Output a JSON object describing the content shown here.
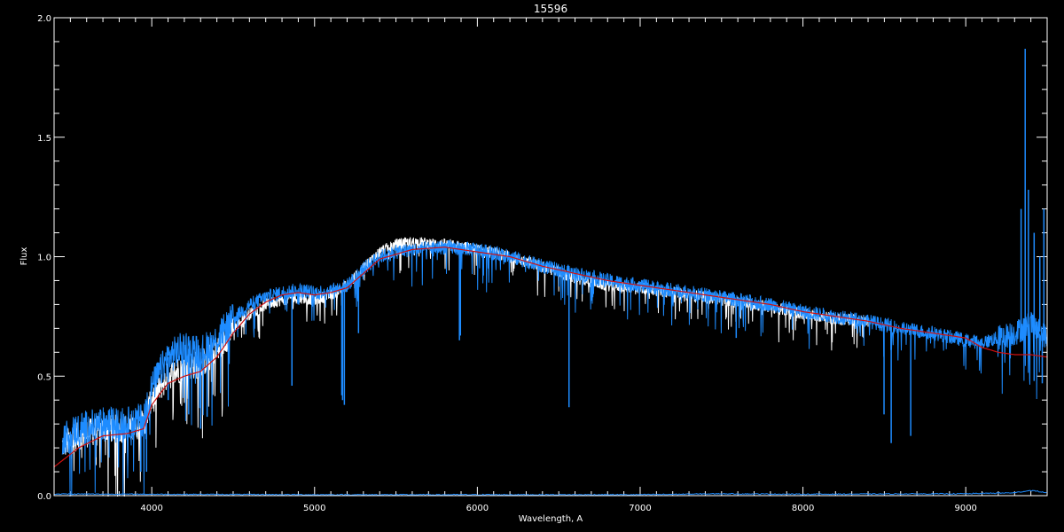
{
  "chart_data": {
    "type": "line",
    "title": "15596",
    "xlabel": "Wavelength, A",
    "ylabel": "Flux",
    "xlim": [
      3400,
      9500
    ],
    "ylim": [
      0.0,
      2.0
    ],
    "grid": false,
    "legend": "none",
    "x_ticks": [
      4000,
      5000,
      6000,
      7000,
      8000,
      9000
    ],
    "x_tick_labels": [
      "4000",
      "5000",
      "6000",
      "7000",
      "8000",
      "9000"
    ],
    "y_ticks": [
      0.0,
      0.5,
      1.0,
      1.5,
      2.0
    ],
    "y_tick_labels": [
      "0.0",
      "0.5",
      "1.0",
      "1.5",
      "2.0"
    ],
    "colors": {
      "background": "#000000",
      "axes": "#ffffff",
      "model_spectrum": "#ffffff",
      "observed_spectrum": "#1e8cff",
      "continuum_fit": "#d01010",
      "error_spectrum": "#1e8cff"
    },
    "series": [
      {
        "id": "continuum_fit",
        "x": [
          3400,
          3550,
          3700,
          3850,
          3950,
          4000,
          4100,
          4200,
          4300,
          4400,
          4500,
          4600,
          4700,
          4800,
          4900,
          5000,
          5100,
          5200,
          5300,
          5400,
          5600,
          5800,
          6000,
          6200,
          6400,
          6600,
          6800,
          7000,
          7200,
          7400,
          7600,
          7800,
          8000,
          8200,
          8400,
          8600,
          8800,
          9000,
          9100,
          9200,
          9300,
          9400,
          9500
        ],
        "y": [
          0.12,
          0.2,
          0.25,
          0.26,
          0.28,
          0.38,
          0.47,
          0.5,
          0.52,
          0.58,
          0.68,
          0.76,
          0.81,
          0.84,
          0.85,
          0.84,
          0.85,
          0.87,
          0.93,
          0.99,
          1.03,
          1.04,
          1.02,
          1.0,
          0.96,
          0.93,
          0.9,
          0.88,
          0.86,
          0.84,
          0.82,
          0.8,
          0.77,
          0.75,
          0.73,
          0.7,
          0.68,
          0.66,
          0.62,
          0.6,
          0.59,
          0.59,
          0.58
        ]
      },
      {
        "id": "model_spectrum",
        "x": [
          3450,
          3550,
          3700,
          3850,
          3950,
          4000,
          4100,
          4200,
          4300,
          4400,
          4500,
          4600,
          4700,
          4800,
          4900,
          5000,
          5100,
          5200,
          5300,
          5400,
          5500,
          5600,
          5800,
          6000,
          6200,
          6400,
          6600,
          6800,
          7000,
          7200,
          7400,
          7600,
          7800,
          8000,
          8200,
          8400
        ],
        "y": [
          0.21,
          0.25,
          0.28,
          0.28,
          0.3,
          0.4,
          0.5,
          0.54,
          0.55,
          0.6,
          0.7,
          0.76,
          0.8,
          0.82,
          0.83,
          0.82,
          0.84,
          0.88,
          0.95,
          1.02,
          1.05,
          1.06,
          1.05,
          1.03,
          1.0,
          0.96,
          0.91,
          0.88,
          0.87,
          0.85,
          0.83,
          0.81,
          0.79,
          0.76,
          0.74,
          0.73
        ]
      },
      {
        "id": "observed_spectrum",
        "x": [
          3450,
          3550,
          3700,
          3850,
          3950,
          4000,
          4100,
          4200,
          4300,
          4400,
          4500,
          4600,
          4700,
          4800,
          4900,
          5000,
          5100,
          5200,
          5300,
          5400,
          5500,
          5600,
          5800,
          6000,
          6200,
          6400,
          6600,
          6800,
          7000,
          7200,
          7400,
          7600,
          7800,
          8000,
          8200,
          8400,
          8600,
          8800,
          9000,
          9100,
          9200,
          9300,
          9400,
          9500
        ],
        "y": [
          0.24,
          0.28,
          0.3,
          0.3,
          0.32,
          0.45,
          0.58,
          0.62,
          0.6,
          0.65,
          0.74,
          0.8,
          0.83,
          0.85,
          0.86,
          0.85,
          0.86,
          0.88,
          0.95,
          1.0,
          1.02,
          1.03,
          1.04,
          1.03,
          1.0,
          0.96,
          0.93,
          0.9,
          0.88,
          0.86,
          0.84,
          0.82,
          0.8,
          0.77,
          0.75,
          0.73,
          0.7,
          0.68,
          0.65,
          0.64,
          0.66,
          0.68,
          0.72,
          0.66
        ]
      },
      {
        "id": "error_spectrum",
        "x": [
          3400,
          4000,
          5000,
          6000,
          7000,
          7500,
          8000,
          8500,
          9000,
          9300,
          9400,
          9500
        ],
        "y": [
          0.005,
          0.004,
          0.002,
          0.002,
          0.002,
          0.006,
          0.004,
          0.005,
          0.006,
          0.01,
          0.02,
          0.01
        ]
      }
    ],
    "observed_absorption_lines": [
      {
        "x": 3933,
        "y": 0.1
      },
      {
        "x": 3968,
        "y": 0.1
      },
      {
        "x": 4101,
        "y": 0.4
      },
      {
        "x": 4227,
        "y": 0.34
      },
      {
        "x": 4300,
        "y": 0.28
      },
      {
        "x": 4340,
        "y": 0.33
      },
      {
        "x": 4861,
        "y": 0.46
      },
      {
        "x": 5167,
        "y": 0.42
      },
      {
        "x": 5172,
        "y": 0.4
      },
      {
        "x": 5183,
        "y": 0.38
      },
      {
        "x": 5270,
        "y": 0.68
      },
      {
        "x": 5890,
        "y": 0.65
      },
      {
        "x": 5896,
        "y": 0.67
      },
      {
        "x": 6563,
        "y": 0.37
      },
      {
        "x": 7590,
        "y": 0.66
      },
      {
        "x": 8498,
        "y": 0.34
      },
      {
        "x": 8542,
        "y": 0.22
      },
      {
        "x": 8662,
        "y": 0.25
      },
      {
        "x": 9420,
        "y": 0.48
      },
      {
        "x": 9470,
        "y": 0.47
      }
    ],
    "observed_emission_spikes": [
      {
        "x": 9340,
        "y": 1.2
      },
      {
        "x": 9365,
        "y": 1.87
      },
      {
        "x": 9385,
        "y": 1.28
      },
      {
        "x": 9420,
        "y": 1.1
      },
      {
        "x": 9455,
        "y": 1.0
      },
      {
        "x": 9480,
        "y": 1.2
      }
    ]
  }
}
